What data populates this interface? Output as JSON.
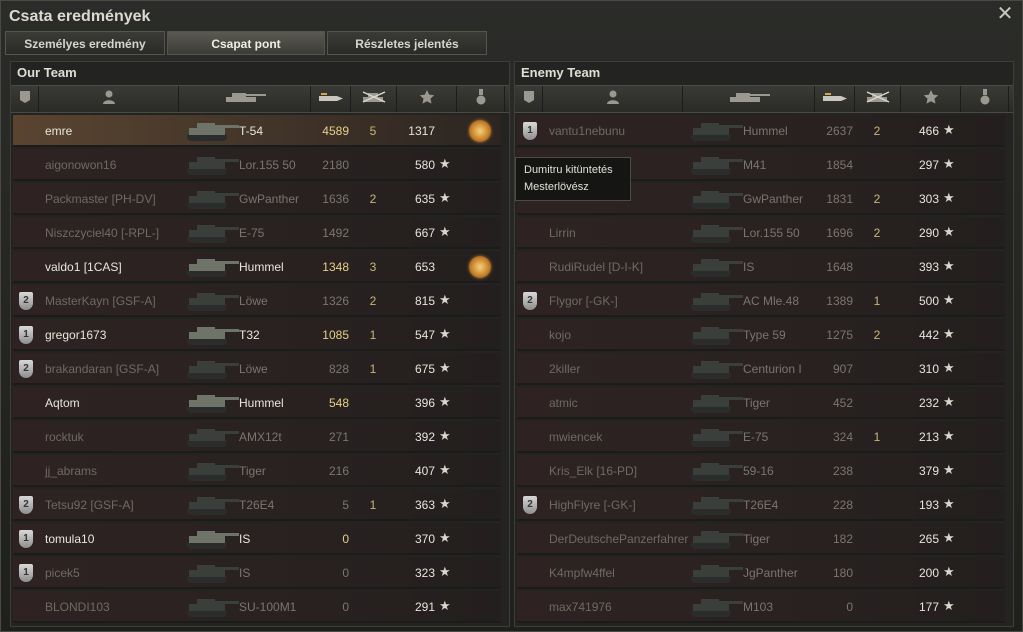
{
  "window": {
    "title": "Csata eredmények"
  },
  "tabs": [
    {
      "label": "Személyes eredmény"
    },
    {
      "label": "Csapat pont"
    },
    {
      "label": "Részletes jelentés"
    }
  ],
  "our_team": {
    "title": "Our Team",
    "players": [
      {
        "name": "emre",
        "vehicle": "T-54",
        "damage": "4589",
        "kills": "5",
        "xp": "1317",
        "badge": "",
        "self": true,
        "alive": true,
        "medal": true
      },
      {
        "name": "aigonowon16",
        "vehicle": "Lor.155 50",
        "damage": "2180",
        "kills": "",
        "xp": "580",
        "badge": "",
        "alive": false
      },
      {
        "name": "Packmaster [PH-DV]",
        "vehicle": "GwPanther",
        "damage": "1636",
        "kills": "2",
        "xp": "635",
        "badge": "",
        "alive": false
      },
      {
        "name": "Niszczyciel40 [-RPL-]",
        "vehicle": "E-75",
        "damage": "1492",
        "kills": "",
        "xp": "667",
        "badge": "",
        "alive": false
      },
      {
        "name": "valdo1 [1CAS]",
        "vehicle": "Hummel",
        "damage": "1348",
        "kills": "3",
        "xp": "653",
        "badge": "",
        "alive": true,
        "medal": true
      },
      {
        "name": "MasterKayn [GSF-A]",
        "vehicle": "Löwe",
        "damage": "1326",
        "kills": "2",
        "xp": "815",
        "badge": "2",
        "alive": false
      },
      {
        "name": "gregor1673",
        "vehicle": "T32",
        "damage": "1085",
        "kills": "1",
        "xp": "547",
        "badge": "1",
        "alive": true
      },
      {
        "name": "brakandaran [GSF-A]",
        "vehicle": "Löwe",
        "damage": "828",
        "kills": "1",
        "xp": "675",
        "badge": "2",
        "alive": false
      },
      {
        "name": "Aqtom",
        "vehicle": "Hummel",
        "damage": "548",
        "kills": "",
        "xp": "396",
        "badge": "",
        "alive": true
      },
      {
        "name": "rocktuk",
        "vehicle": "AMX12t",
        "damage": "271",
        "kills": "",
        "xp": "392",
        "badge": "",
        "alive": false
      },
      {
        "name": "jj_abrams",
        "vehicle": "Tiger",
        "damage": "216",
        "kills": "",
        "xp": "407",
        "badge": "",
        "alive": false
      },
      {
        "name": "Tetsu92 [GSF-A]",
        "vehicle": "T26E4",
        "damage": "5",
        "kills": "1",
        "xp": "363",
        "badge": "2",
        "alive": false
      },
      {
        "name": "tomula10",
        "vehicle": "IS",
        "damage": "0",
        "kills": "",
        "xp": "370",
        "badge": "1",
        "alive": true
      },
      {
        "name": "picek5",
        "vehicle": "IS",
        "damage": "0",
        "kills": "",
        "xp": "323",
        "badge": "1",
        "alive": false
      },
      {
        "name": "BLONDI103",
        "vehicle": "SU-100M1",
        "damage": "0",
        "kills": "",
        "xp": "291",
        "badge": "",
        "alive": false
      }
    ]
  },
  "enemy_team": {
    "title": "Enemy Team",
    "players": [
      {
        "name": "vantu1nebunu",
        "vehicle": "Hummel",
        "damage": "2637",
        "kills": "2",
        "xp": "466",
        "badge": "1"
      },
      {
        "name": "",
        "vehicle": "M41",
        "damage": "1854",
        "kills": "",
        "xp": "297",
        "badge": ""
      },
      {
        "name": "",
        "vehicle": "GwPanther",
        "damage": "1831",
        "kills": "2",
        "xp": "303",
        "badge": ""
      },
      {
        "name": "Lirrin",
        "vehicle": "Lor.155 50",
        "damage": "1696",
        "kills": "2",
        "xp": "290",
        "badge": ""
      },
      {
        "name": "RudiRudel [D-I-K]",
        "vehicle": "IS",
        "damage": "1648",
        "kills": "",
        "xp": "393",
        "badge": ""
      },
      {
        "name": "Flygor [-GK-]",
        "vehicle": "AC Mle.48",
        "damage": "1389",
        "kills": "1",
        "xp": "500",
        "badge": "2"
      },
      {
        "name": "kojo",
        "vehicle": "Type 59",
        "damage": "1275",
        "kills": "2",
        "xp": "442",
        "badge": ""
      },
      {
        "name": "2killer",
        "vehicle": "Centurion I",
        "damage": "907",
        "kills": "",
        "xp": "310",
        "badge": ""
      },
      {
        "name": "atmic",
        "vehicle": "Tiger",
        "damage": "452",
        "kills": "",
        "xp": "232",
        "badge": ""
      },
      {
        "name": "mwiencek",
        "vehicle": "E-75",
        "damage": "324",
        "kills": "1",
        "xp": "213",
        "badge": ""
      },
      {
        "name": "Kris_Elk [16-PD]",
        "vehicle": "59-16",
        "damage": "238",
        "kills": "",
        "xp": "379",
        "badge": ""
      },
      {
        "name": "HighFlyre [-GK-]",
        "vehicle": "T26E4",
        "damage": "228",
        "kills": "",
        "xp": "193",
        "badge": "2"
      },
      {
        "name": "DerDeutschePanzerfahrer",
        "vehicle": "Tiger",
        "damage": "182",
        "kills": "",
        "xp": "265",
        "badge": ""
      },
      {
        "name": "K4mpfw4ffel",
        "vehicle": "JgPanther",
        "damage": "180",
        "kills": "",
        "xp": "200",
        "badge": ""
      },
      {
        "name": "max741976",
        "vehicle": "M103",
        "damage": "0",
        "kills": "",
        "xp": "177",
        "badge": ""
      }
    ]
  },
  "tooltip": {
    "line1": "Dumitru kitüntetés",
    "line2": "Mesterlövész"
  },
  "icons": {
    "close": "close-icon",
    "col_badge": "badge-icon",
    "col_player": "player-icon",
    "col_vehicle": "tank-icon",
    "col_damage": "shell-icon",
    "col_kills": "destroyed-tank-icon",
    "col_xp": "star-icon",
    "col_medal": "medal-icon"
  }
}
